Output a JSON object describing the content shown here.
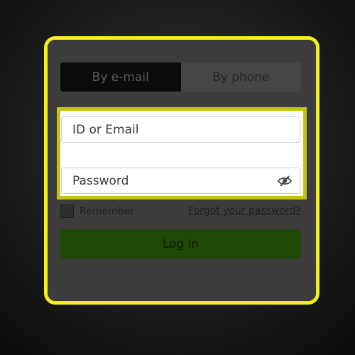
{
  "tabs": [
    {
      "label": "By e-mail",
      "active": true
    },
    {
      "label": "By phone",
      "active": false
    }
  ],
  "form": {
    "email": {
      "value": "",
      "placeholder": "ID or Email"
    },
    "password": {
      "value": "",
      "placeholder": "Password",
      "visibility_icon": "eye-slash-icon"
    },
    "remember_label": "Remember",
    "remember_checked": false,
    "forgot_label": "Forgot your password?",
    "login_label": "Log in"
  },
  "colors": {
    "highlight": "#f6ef1c",
    "login_button": "#1f4a06"
  }
}
